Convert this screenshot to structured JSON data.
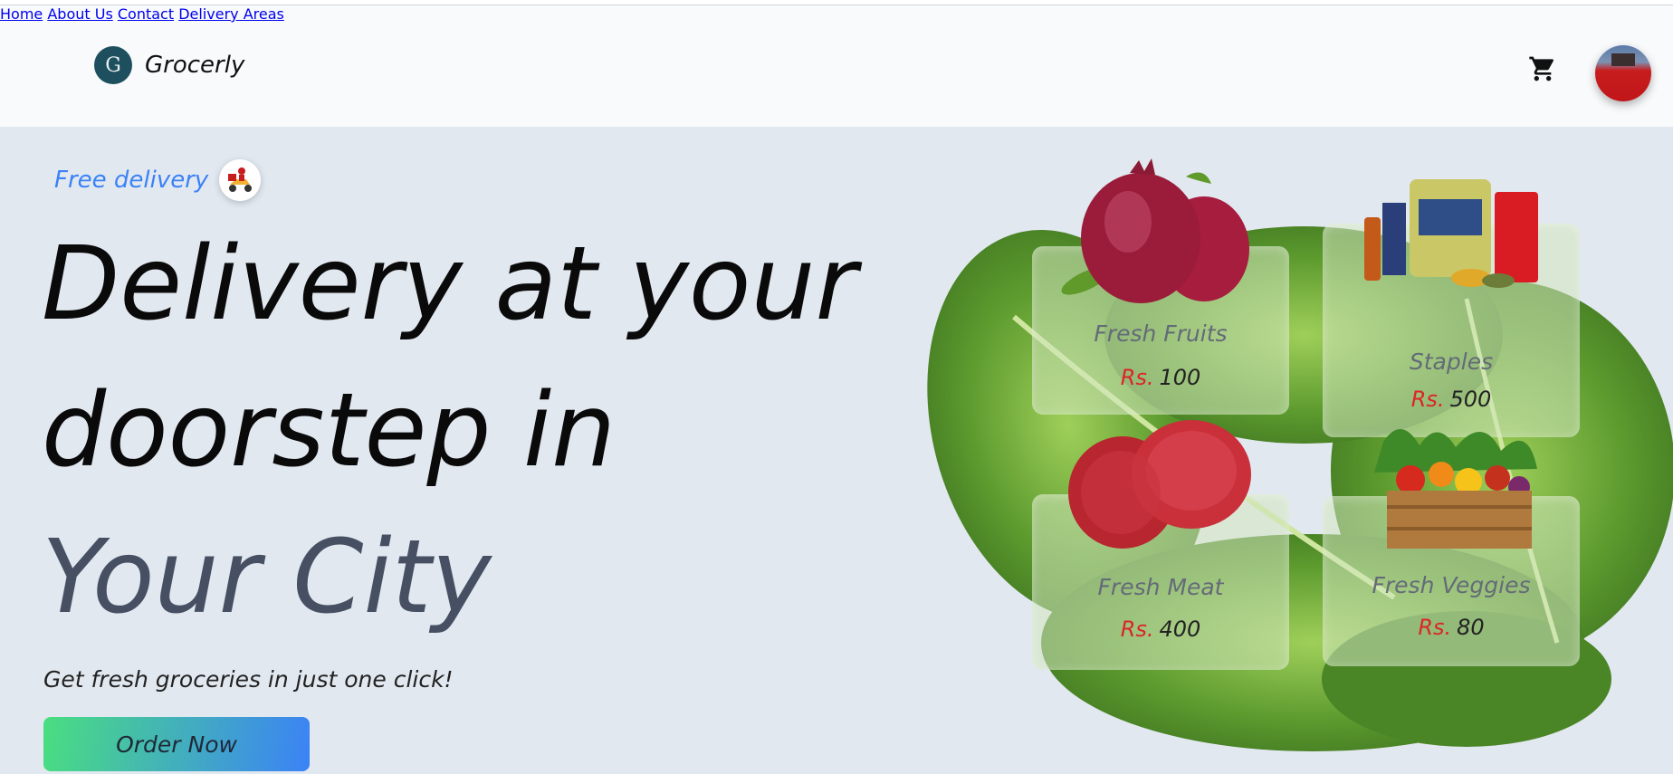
{
  "brand": {
    "logo_letter": "G",
    "name": "Grocerly"
  },
  "nav": {
    "items": [
      "Home",
      "About Us",
      "Contact",
      "Delivery Areas"
    ]
  },
  "hero": {
    "badge": "Free delivery",
    "line1": "Delivery at your",
    "line2": "doorstep in",
    "line3": "Your City",
    "subtitle": "Get fresh groceries in just one click!",
    "cta": "Order Now"
  },
  "cards": [
    {
      "name": "Fresh Fruits",
      "currency": "Rs.",
      "price": "100"
    },
    {
      "name": "Staples",
      "currency": "Rs.",
      "price": "500"
    },
    {
      "name": "Fresh Meat",
      "currency": "Rs.",
      "price": "400"
    },
    {
      "name": "Fresh Veggies",
      "currency": "Rs.",
      "price": "80"
    }
  ],
  "colors": {
    "accent_blue": "#3b82f6",
    "price_red": "#dc2626",
    "cta_gradient_start": "#4ade80",
    "cta_gradient_end": "#3b82f6"
  },
  "icons": {
    "cart": "cart-icon",
    "avatar": "avatar",
    "scooter": "delivery-scooter-icon"
  }
}
